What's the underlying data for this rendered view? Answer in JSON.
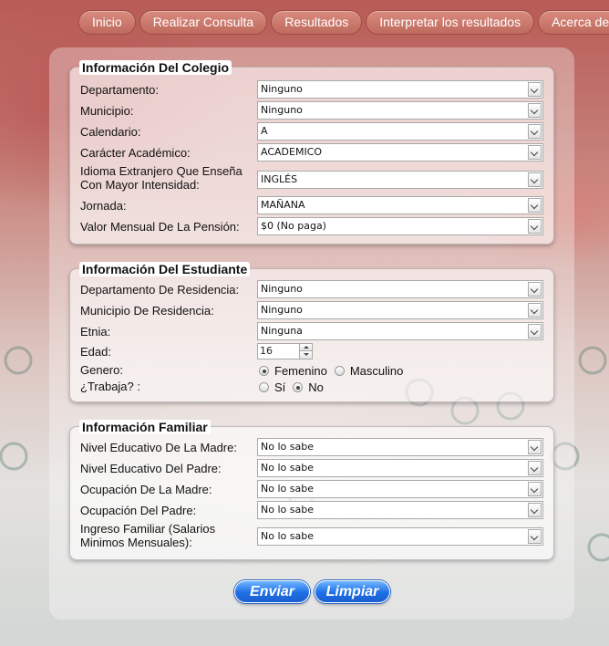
{
  "nav": {
    "items": [
      "Inicio",
      "Realizar Consulta",
      "Resultados",
      "Interpretar los resultados",
      "Acerca de"
    ]
  },
  "colegio": {
    "title": "Información Del Colegio",
    "fields": [
      {
        "label": "Departamento:",
        "value": "Ninguno"
      },
      {
        "label": "Municipio:",
        "value": "Ninguno"
      },
      {
        "label": "Calendario:",
        "value": "A"
      },
      {
        "label": "Carácter Académico:",
        "value": "ACADEMICO"
      },
      {
        "label": "Idioma Extranjero Que Enseña Con Mayor Intensidad:",
        "value": "INGLÉS"
      },
      {
        "label": "Jornada:",
        "value": "MAÑANA"
      },
      {
        "label": "Valor Mensual De La Pensión:",
        "value": "$0 (No paga)"
      }
    ]
  },
  "estudiante": {
    "title": "Información Del Estudiante",
    "fields": [
      {
        "label": "Departamento De Residencia:",
        "value": "Ninguno"
      },
      {
        "label": "Municipio De Residencia:",
        "value": "Ninguno"
      },
      {
        "label": "Etnia:",
        "value": "Ninguna"
      }
    ],
    "edad": {
      "label": "Edad:",
      "value": "16"
    },
    "genero": {
      "label": "Genero:",
      "options": [
        "Femenino",
        "Masculino"
      ],
      "selected": "Femenino"
    },
    "trabaja": {
      "label": "¿Trabaja? :",
      "options": [
        "Sí",
        "No"
      ],
      "selected": "No"
    }
  },
  "familiar": {
    "title": "Información Familiar",
    "fields": [
      {
        "label": "Nivel Educativo De La Madre:",
        "value": "No lo sabe"
      },
      {
        "label": "Nivel Educativo Del Padre:",
        "value": "No lo sabe"
      },
      {
        "label": "Ocupación De La Madre:",
        "value": "No lo sabe"
      },
      {
        "label": "Ocupación Del Padre:",
        "value": "No lo sabe"
      },
      {
        "label": "Ingreso Familiar (Salarios Minimos Mensuales):",
        "value": "No lo sabe"
      }
    ]
  },
  "actions": {
    "submit": "Enviar",
    "reset": "Limpiar"
  }
}
